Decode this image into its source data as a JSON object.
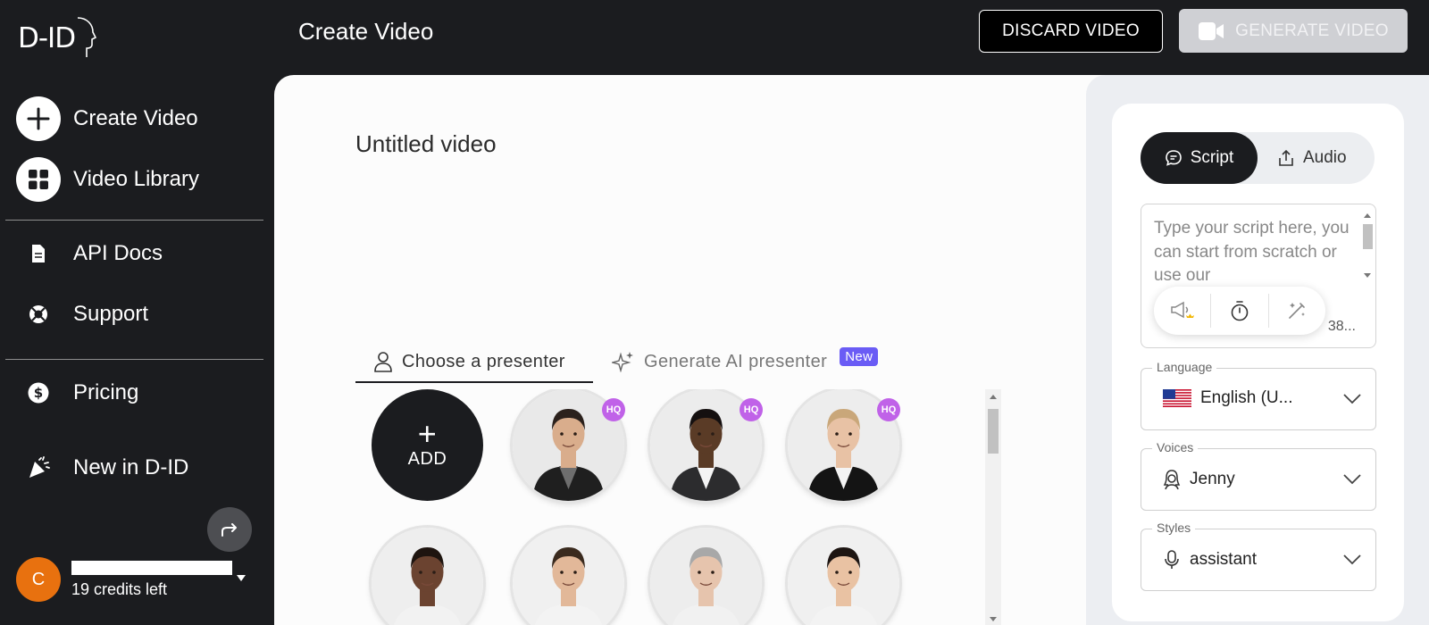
{
  "app": {
    "logo_text": "D-ID",
    "page_title": "Create Video"
  },
  "header": {
    "discard_label": "DISCARD VIDEO",
    "generate_label": "GENERATE VIDEO"
  },
  "sidebar": {
    "items": [
      {
        "label": "Create Video",
        "icon": "plus-icon"
      },
      {
        "label": "Video Library",
        "icon": "grid-icon"
      },
      {
        "label": "API Docs",
        "icon": "document-icon"
      },
      {
        "label": "Support",
        "icon": "lifebuoy-icon"
      },
      {
        "label": "Pricing",
        "icon": "dollar-icon"
      },
      {
        "label": "New in D-ID",
        "icon": "party-popper-icon"
      }
    ],
    "user": {
      "avatar_initial": "C",
      "credits": "19 credits left"
    }
  },
  "main": {
    "video_title": "Untitled video",
    "tabs": [
      {
        "label": "Choose a presenter",
        "active": true
      },
      {
        "label": "Generate AI presenter",
        "badge": "New"
      }
    ],
    "add_label": "ADD",
    "add_plus": "+",
    "presenters": [
      {
        "badge": "HQ",
        "skin": "#d9ad8c",
        "hair": "#2b211c",
        "outfit": "#1f1f1f",
        "shirt": "#6e6e6e",
        "bg": "#e9e9e9"
      },
      {
        "badge": "HQ",
        "skin": "#5a3b26",
        "hair": "#151010",
        "outfit": "#2c2c2e",
        "shirt": "#f4f4f4",
        "bg": "#ececec"
      },
      {
        "badge": "HQ",
        "skin": "#e8c2a5",
        "hair": "#c9a77a",
        "outfit": "#141414",
        "shirt": "#f4f4f4",
        "bg": "#ededed"
      },
      {
        "badge": "",
        "skin": "#6b4330",
        "hair": "#1e140f",
        "outfit": "#f2f2f2",
        "shirt": "#f2f2f2",
        "bg": "#eeeeee"
      },
      {
        "badge": "",
        "skin": "#e2b899",
        "hair": "#3a2a1e",
        "outfit": "#f3f3f3",
        "shirt": "#f3f3f3",
        "bg": "#f0f0f0"
      },
      {
        "badge": "",
        "skin": "#e6c4ad",
        "hair": "#a8a8a8",
        "outfit": "#f1f1f1",
        "shirt": "#f1f1f1",
        "bg": "#ededed"
      },
      {
        "badge": "",
        "skin": "#e9c2a3",
        "hair": "#1d1512",
        "outfit": "#f3f3f3",
        "shirt": "#f3f3f3",
        "bg": "#f0f0f0"
      }
    ]
  },
  "panel": {
    "tabs": {
      "script": "Script",
      "audio": "Audio"
    },
    "script_placeholder": "Type your script here, you can start from scratch or use our",
    "char_count": "38...",
    "language": {
      "label": "Language",
      "value": "English (U...",
      "flag": "us-flag-icon"
    },
    "voices": {
      "label": "Voices",
      "value": "Jenny"
    },
    "styles": {
      "label": "Styles",
      "value": "assistant"
    }
  },
  "colors": {
    "sidebar_bg": "#1b1c1f",
    "accent_purple": "#6a5cf5",
    "hq_badge": "#c062e8",
    "avatar_orange": "#e8710f"
  }
}
